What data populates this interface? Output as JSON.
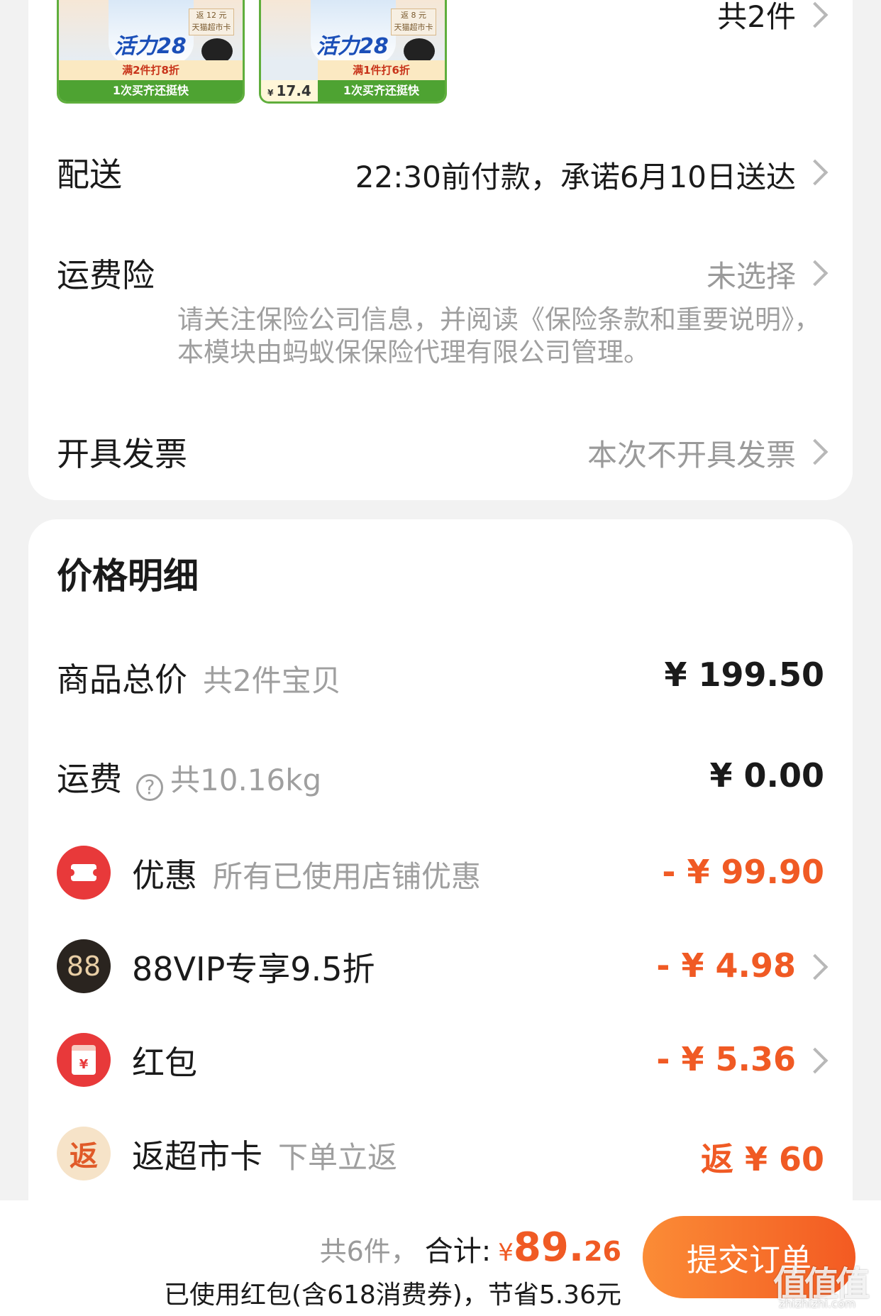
{
  "products": {
    "count_label": "共2件",
    "items": [
      {
        "brand": "活力28",
        "rebate_amount": "返 12 元",
        "rebate_card": "天猫超市卡",
        "promo": "满2件打8折",
        "strip": "1次买齐还挺快"
      },
      {
        "brand": "活力28",
        "rebate_amount": "返 8 元",
        "rebate_card": "天猫超市卡",
        "promo": "满1件打6折",
        "price": "17.4",
        "currency": "¥",
        "strip": "1次买齐还挺快"
      }
    ]
  },
  "delivery": {
    "label": "配送",
    "value": "22:30前付款，承诺6月10日送达"
  },
  "insurance": {
    "label": "运费险",
    "value": "未选择",
    "note": "请关注保险公司信息，并阅读《保险条款和重要说明》，本模块由蚂蚁保保险代理有限公司管理。"
  },
  "invoice": {
    "label": "开具发票",
    "value": "本次不开具发票"
  },
  "price_detail": {
    "title": "价格明细",
    "goods_total": {
      "label": "商品总价",
      "sub": "共2件宝贝",
      "value": "¥ 199.50"
    },
    "shipping": {
      "label": "运费",
      "sub": "共10.16kg",
      "value": "¥ 0.00",
      "help_glyph": "?"
    },
    "discount": {
      "label": "优惠",
      "sub": "所有已使用店铺优惠",
      "value": "- ¥ 99.90",
      "icon": "ticket-icon"
    },
    "vip": {
      "label": "88VIP专享9.5折",
      "value": "- ¥ 4.98",
      "icon_text": "88"
    },
    "red_packet": {
      "label": "红包",
      "value": "- ¥ 5.36",
      "icon_text": "¥"
    },
    "supermarket_card": {
      "label": "返超市卡",
      "sub": "下单立返",
      "value": "返 ¥ 60",
      "icon_text": "返"
    }
  },
  "bottom_bar": {
    "count": "共6件，",
    "total_label": "合计:",
    "currency": "¥",
    "total_int": "89.",
    "total_dec": "26",
    "saving_note": "已使用红包(含618消费券)，节省5.36元",
    "submit_label": "提交订单"
  },
  "watermark": {
    "text": "值值值",
    "url": "zhizhizhi.com"
  },
  "colors": {
    "accent": "#f05a24",
    "button_start": "#fb8c36",
    "button_end": "#f35a22",
    "page_bg": "#f2f2f2"
  }
}
